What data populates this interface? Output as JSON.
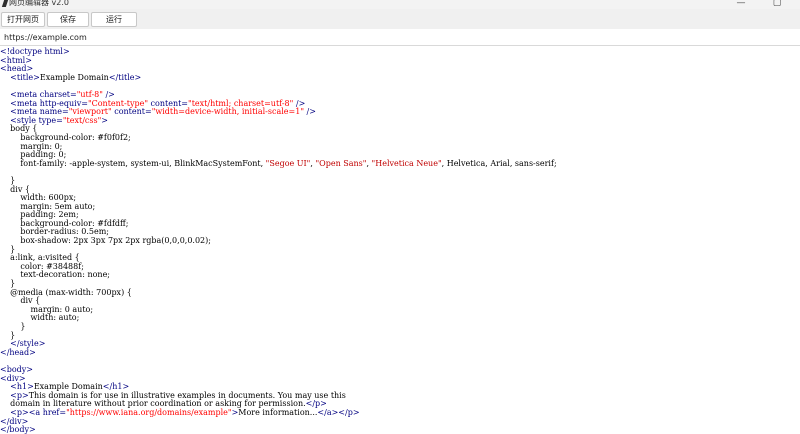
{
  "window": {
    "title": "网页编辑器 v2.0",
    "minimize_symbol": "—",
    "maximize_symbol": "▢"
  },
  "toolbar": {
    "open_label": "打开网页",
    "save_label": "保存",
    "run_label": "运行"
  },
  "url": {
    "value": "https://example.com"
  },
  "colors": {
    "tag": "#000080",
    "attr_value": "#ff0000",
    "text": "#000000"
  },
  "editor": {
    "lines": [
      [
        [
          "t",
          "<!doctype html>"
        ]
      ],
      [
        [
          "t",
          "<html>"
        ]
      ],
      [
        [
          "t",
          "<head>"
        ]
      ],
      [
        [
          "x",
          "    "
        ],
        [
          "t",
          "<title>"
        ],
        [
          "x",
          "Example Domain"
        ],
        [
          "t",
          "</title>"
        ]
      ],
      [
        [
          "x",
          ""
        ]
      ],
      [
        [
          "x",
          "    "
        ],
        [
          "t",
          "<meta "
        ],
        [
          "t",
          "charset="
        ],
        [
          "v",
          "\"utf-8\""
        ],
        [
          "t",
          " />"
        ]
      ],
      [
        [
          "x",
          "    "
        ],
        [
          "t",
          "<meta "
        ],
        [
          "t",
          "http-equiv="
        ],
        [
          "v",
          "\"Content-type\""
        ],
        [
          "t",
          " content="
        ],
        [
          "v",
          "\"text/html; charset=utf-8\""
        ],
        [
          "t",
          " />"
        ]
      ],
      [
        [
          "x",
          "    "
        ],
        [
          "t",
          "<meta "
        ],
        [
          "t",
          "name="
        ],
        [
          "v",
          "\"viewport\""
        ],
        [
          "t",
          " content="
        ],
        [
          "v",
          "\"width=device-width, initial-scale=1\""
        ],
        [
          "t",
          " />"
        ]
      ],
      [
        [
          "x",
          "    "
        ],
        [
          "t",
          "<style "
        ],
        [
          "t",
          "type="
        ],
        [
          "v",
          "\"text/css\""
        ],
        [
          "t",
          ">"
        ]
      ],
      [
        [
          "x",
          "    body {"
        ]
      ],
      [
        [
          "x",
          "        background-color: #f0f0f2;"
        ]
      ],
      [
        [
          "x",
          "        margin: 0;"
        ]
      ],
      [
        [
          "x",
          "        padding: 0;"
        ]
      ],
      [
        [
          "x",
          "        font-family: -apple-system, system-ui, BlinkMacSystemFont, "
        ],
        [
          "s",
          "\"Segoe UI\""
        ],
        [
          "x",
          ", "
        ],
        [
          "s",
          "\"Open Sans\""
        ],
        [
          "x",
          ", "
        ],
        [
          "s",
          "\"Helvetica Neue\""
        ],
        [
          "x",
          ", Helvetica, Arial, sans-serif;"
        ]
      ],
      [
        [
          "x",
          ""
        ]
      ],
      [
        [
          "x",
          "    }"
        ]
      ],
      [
        [
          "x",
          "    div {"
        ]
      ],
      [
        [
          "x",
          "        width: 600px;"
        ]
      ],
      [
        [
          "x",
          "        margin: 5em auto;"
        ]
      ],
      [
        [
          "x",
          "        padding: 2em;"
        ]
      ],
      [
        [
          "x",
          "        background-color: #fdfdff;"
        ]
      ],
      [
        [
          "x",
          "        border-radius: 0.5em;"
        ]
      ],
      [
        [
          "x",
          "        box-shadow: 2px 3px 7px 2px rgba(0,0,0,0.02);"
        ]
      ],
      [
        [
          "x",
          "    }"
        ]
      ],
      [
        [
          "x",
          "    a:link, a:visited {"
        ]
      ],
      [
        [
          "x",
          "        color: #38488f;"
        ]
      ],
      [
        [
          "x",
          "        text-decoration: none;"
        ]
      ],
      [
        [
          "x",
          "    }"
        ]
      ],
      [
        [
          "x",
          "    @media (max-width: 700px) {"
        ]
      ],
      [
        [
          "x",
          "        div {"
        ]
      ],
      [
        [
          "x",
          "            margin: 0 auto;"
        ]
      ],
      [
        [
          "x",
          "            width: auto;"
        ]
      ],
      [
        [
          "x",
          "        }"
        ]
      ],
      [
        [
          "x",
          "    }"
        ]
      ],
      [
        [
          "x",
          "    "
        ],
        [
          "t",
          "</style>"
        ]
      ],
      [
        [
          "t",
          "</head>"
        ]
      ],
      [
        [
          "x",
          ""
        ]
      ],
      [
        [
          "t",
          "<body>"
        ]
      ],
      [
        [
          "t",
          "<div>"
        ]
      ],
      [
        [
          "x",
          "    "
        ],
        [
          "t",
          "<h1>"
        ],
        [
          "x",
          "Example Domain"
        ],
        [
          "t",
          "</h1>"
        ]
      ],
      [
        [
          "x",
          "    "
        ],
        [
          "t",
          "<p>"
        ],
        [
          "x",
          "This domain is for use in illustrative examples in documents. You may use this"
        ]
      ],
      [
        [
          "x",
          "    domain in literature without prior coordination or asking for permission."
        ],
        [
          "t",
          "</p>"
        ]
      ],
      [
        [
          "x",
          "    "
        ],
        [
          "t",
          "<p><a "
        ],
        [
          "t",
          "href="
        ],
        [
          "v",
          "\"https://www.iana.org/domains/example\""
        ],
        [
          "t",
          ">"
        ],
        [
          "x",
          "More information..."
        ],
        [
          "t",
          "</a></p>"
        ]
      ],
      [
        [
          "t",
          "</div>"
        ]
      ],
      [
        [
          "t",
          "</body>"
        ]
      ]
    ]
  }
}
